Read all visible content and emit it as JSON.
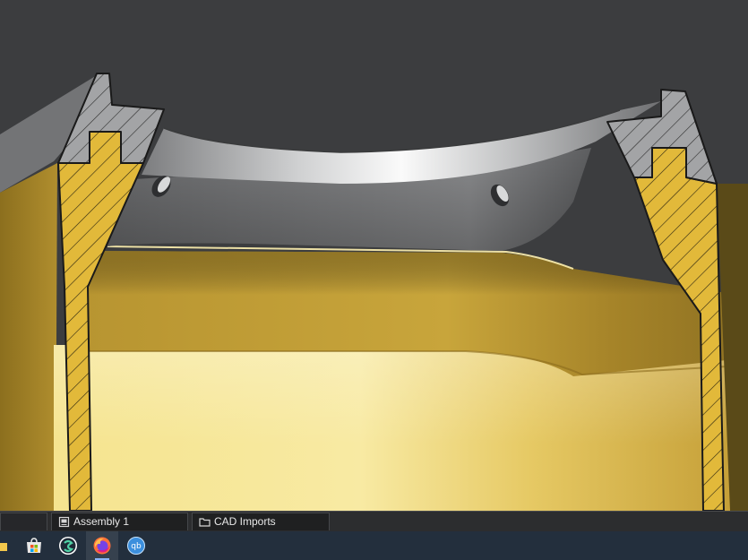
{
  "tabs": [
    {
      "label": "Assembly 1",
      "icon": "assembly-document-icon"
    },
    {
      "label": "CAD Imports",
      "icon": "folder-icon"
    }
  ],
  "taskbar": {
    "apps": [
      {
        "name": "file-explorer",
        "icon": "folder-icon"
      },
      {
        "name": "microsoft-store",
        "icon": "store-icon"
      },
      {
        "name": "onshape",
        "icon": "onshape-icon"
      },
      {
        "name": "firefox",
        "icon": "firefox-icon",
        "active": true
      },
      {
        "name": "qbittorrent",
        "icon": "qbittorrent-icon",
        "label": "qb"
      }
    ]
  },
  "colors": {
    "background": "#3c3d3f",
    "part_yellow": "#c9a436",
    "part_yellow_light": "#f4e28c",
    "part_gray": "#8a8b8d",
    "tab_bar": "#2c2d2f",
    "taskbar": "#232f3d",
    "taskbar_active_indicator": "#8ab4f8"
  }
}
